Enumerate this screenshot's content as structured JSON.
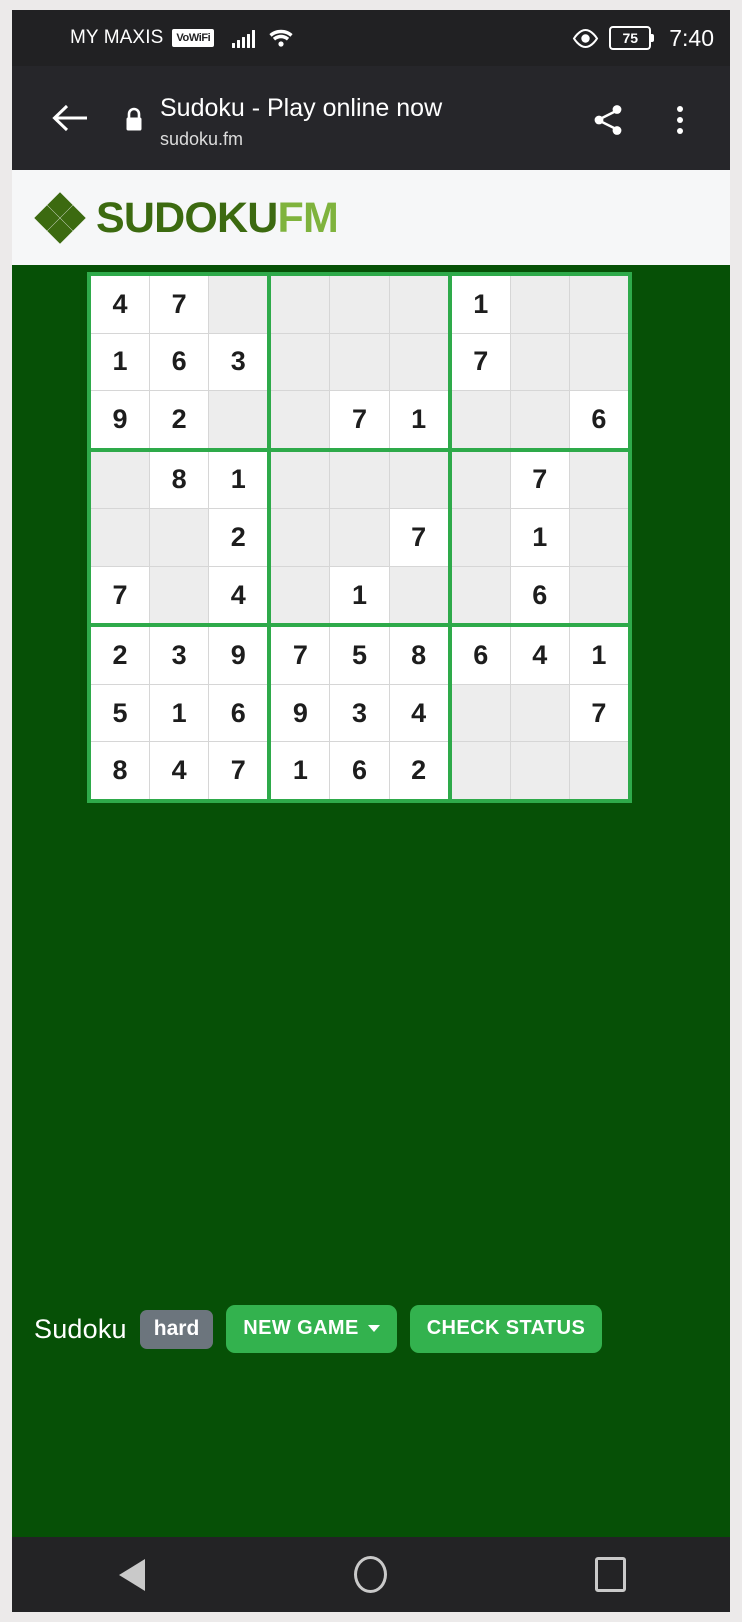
{
  "status_bar": {
    "carrier": "MY MAXIS",
    "vowifi_badge": "VoWiFi",
    "signal_icon": "signal-bars-icon",
    "wifi_icon": "wifi-icon",
    "eye_icon": "eye-icon",
    "battery_level": "75",
    "time": "7:40"
  },
  "toolbar": {
    "back_icon": "back-arrow-icon",
    "lock_icon": "lock-icon",
    "title": "Sudoku - Play online now",
    "url": "sudoku.fm",
    "share_icon": "share-icon",
    "menu_icon": "overflow-menu-icon"
  },
  "site_header": {
    "logo_icon": "diamond-logo-icon",
    "logo_primary": "SUDOKU",
    "logo_secondary": "FM",
    "colors": {
      "logo_primary": "#3c6a10",
      "logo_secondary": "#7fb33d",
      "header_bg": "#f6f7f8"
    }
  },
  "board": {
    "colors": {
      "page_bg": "#065006",
      "box_border": "#2eaa4a",
      "given_cell_bg": "#ffffff",
      "empty_cell_bg": "#ededed",
      "digit": "#1d1d1d"
    },
    "rows": [
      [
        "4",
        "7",
        "",
        "",
        "",
        "",
        "1",
        "",
        ""
      ],
      [
        "1",
        "6",
        "3",
        "",
        "",
        "",
        "7",
        "",
        ""
      ],
      [
        "9",
        "2",
        "",
        "",
        "7",
        "1",
        "",
        "",
        "6"
      ],
      [
        "",
        "8",
        "1",
        "",
        "",
        "",
        "",
        "7",
        ""
      ],
      [
        "",
        "",
        "2",
        "",
        "",
        "7",
        "",
        "1",
        ""
      ],
      [
        "7",
        "",
        "4",
        "",
        "1",
        "",
        "",
        "6",
        ""
      ],
      [
        "2",
        "3",
        "9",
        "7",
        "5",
        "8",
        "6",
        "4",
        "1"
      ],
      [
        "5",
        "1",
        "6",
        "9",
        "3",
        "4",
        "",
        "",
        "7"
      ],
      [
        "8",
        "4",
        "7",
        "1",
        "6",
        "2",
        "",
        "",
        ""
      ]
    ]
  },
  "controls": {
    "title": "Sudoku",
    "difficulty": "hard",
    "new_game_label": "NEW GAME",
    "new_game_caret": "caret-down-icon",
    "check_status_label": "CHECK STATUS",
    "button_color": "#33b24e",
    "badge_color": "#6c757d"
  },
  "nav_bar": {
    "back_icon": "nav-back-icon",
    "home_icon": "nav-home-icon",
    "recents_icon": "nav-recents-icon"
  }
}
